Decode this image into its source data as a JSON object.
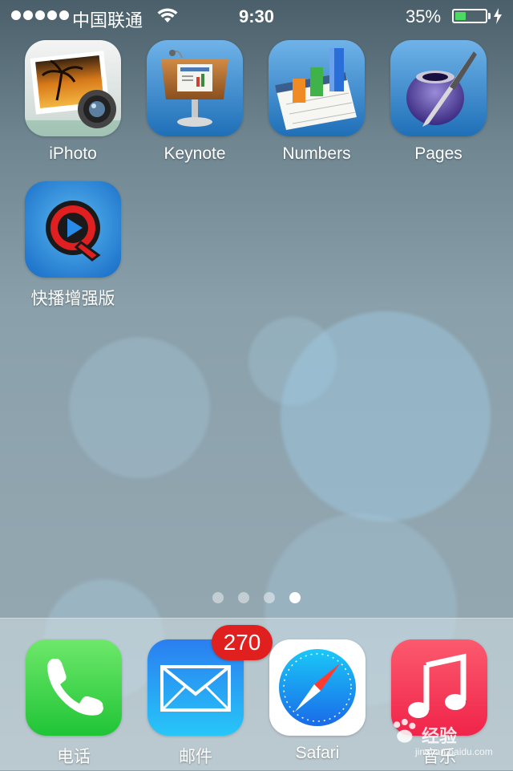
{
  "status_bar": {
    "carrier": "中国联通",
    "time": "9:30",
    "battery_percent": "35%",
    "battery_level": 0.35,
    "charging": true
  },
  "apps": [
    {
      "label": "iPhoto",
      "icon": "iphoto-icon"
    },
    {
      "label": "Keynote",
      "icon": "keynote-icon"
    },
    {
      "label": "Numbers",
      "icon": "numbers-icon"
    },
    {
      "label": "Pages",
      "icon": "pages-icon"
    },
    {
      "label": "快播增强版",
      "icon": "qvod-icon"
    }
  ],
  "page_indicator": {
    "pages": 4,
    "current": 4
  },
  "dock": [
    {
      "label": "电话",
      "icon": "phone-icon"
    },
    {
      "label": "邮件",
      "icon": "mail-icon",
      "badge": "270"
    },
    {
      "label": "Safari",
      "icon": "safari-icon"
    },
    {
      "label": "音乐",
      "icon": "music-icon"
    }
  ],
  "watermark": {
    "text": "经验",
    "url": "jingyan.baidu.com"
  },
  "colors": {
    "battery_fill": "#4cd964",
    "badge": "#e0201f",
    "phone": "#34c84a",
    "mail": "#1e88f0",
    "music": "#f0304a"
  }
}
